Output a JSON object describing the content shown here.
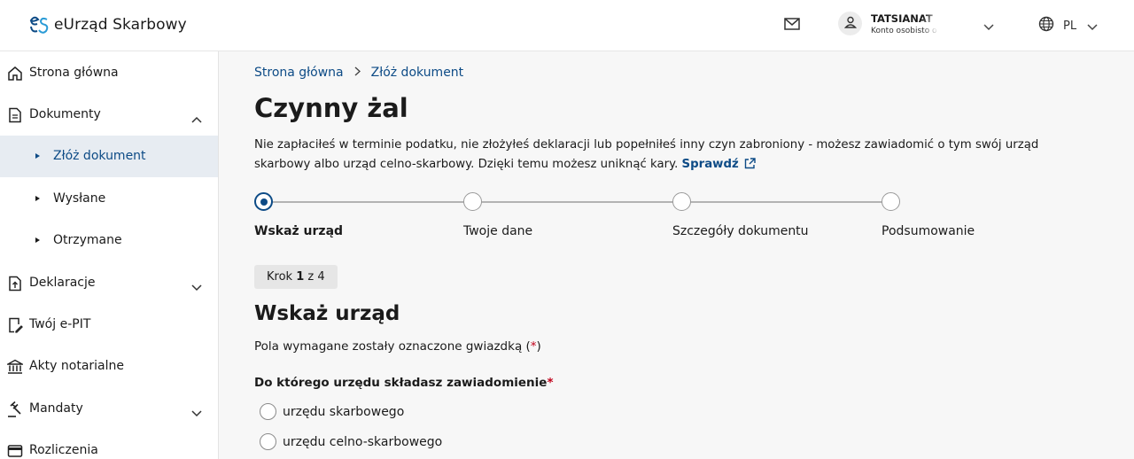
{
  "header": {
    "logo_text": "eUrząd Skarbowy",
    "user": {
      "name": "TATSIANAT",
      "subtitle": "Konto osobisto o"
    },
    "language": "PL"
  },
  "sidebar": {
    "items": [
      {
        "label": "Strona główna",
        "icon": "home-icon"
      },
      {
        "label": "Dokumenty",
        "icon": "document-icon",
        "expanded": true
      },
      {
        "label": "Złóż dokument",
        "sub": true,
        "active": true
      },
      {
        "label": "Wysłane",
        "sub": true
      },
      {
        "label": "Otrzymane",
        "sub": true
      },
      {
        "label": "Deklaracje",
        "icon": "upload-file-icon",
        "expanded": false
      },
      {
        "label": "Twój e-PIT",
        "icon": "edit-file-icon"
      },
      {
        "label": "Akty notarialne",
        "icon": "institution-icon"
      },
      {
        "label": "Mandaty",
        "icon": "gavel-icon",
        "expanded": false
      },
      {
        "label": "Rozliczenia",
        "icon": "wallet-icon"
      }
    ]
  },
  "breadcrumb": {
    "home": "Strona główna",
    "current": "Złóż dokument"
  },
  "page": {
    "title": "Czynny żal",
    "description": "Nie zapłaciłeś w terminie podatku, nie złożyłeś deklaracji lub popełniłeś inny czyn zabroniony - możesz zawiadomić o tym swój urząd skarbowy albo urząd celno-skarbowy. Dzięki temu możesz uniknąć kary.",
    "check_link": "Sprawdź"
  },
  "stepper": {
    "steps": [
      "Wskaż urząd",
      "Twoje dane",
      "Szczegóły dokumentu",
      "Podsumowanie"
    ],
    "current": 1,
    "badge_prefix": "Krok",
    "badge_current": "1",
    "badge_suffix": "z 4"
  },
  "form": {
    "section_title": "Wskaż urząd",
    "required_note_before": "Pola wymagane zostały oznaczone gwiazdką (",
    "required_star": "*",
    "required_note_after": ")",
    "question": "Do którego urzędu składasz zawiadomienie",
    "options": [
      "urzędu skarbowego",
      "urzędu celno-skarbowego"
    ]
  },
  "colors": {
    "accent": "#0d4b86",
    "required": "#c0001a",
    "sidebar_active_bg": "#e7ecf2"
  }
}
